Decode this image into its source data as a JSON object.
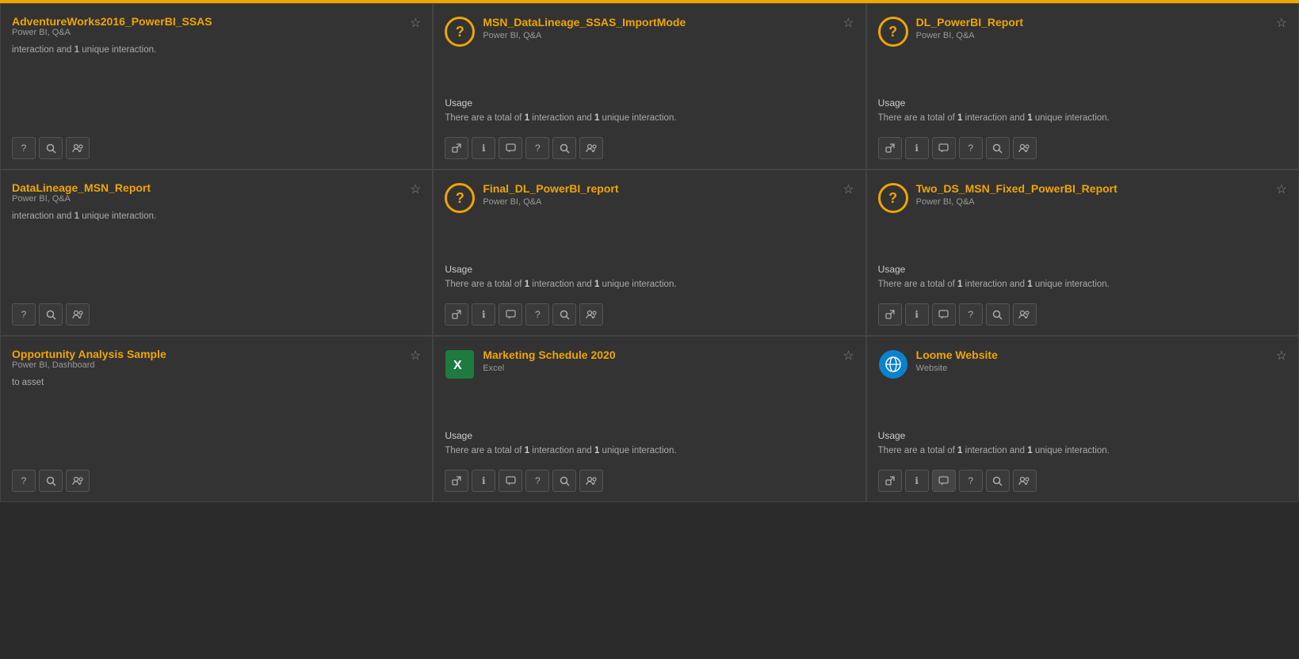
{
  "topBar": {},
  "cards": [
    {
      "id": "adventureworks",
      "partial": true,
      "title": "AdventureWorks2016_PowerBI_SSAS",
      "subtitle": "Power BI, Q&A",
      "iconType": "none",
      "usageLabel": "",
      "usageText": "interaction and",
      "usageBold": "1",
      "usageTextAfter": "unique interaction.",
      "starred": false,
      "buttons": [
        "external",
        "info",
        "search",
        "users"
      ]
    },
    {
      "id": "msn-datalineage",
      "partial": false,
      "title": "MSN_DataLineage_SSAS_ImportMode",
      "subtitle": "Power BI, Q&A",
      "iconType": "question",
      "usageLabel": "Usage",
      "usageTextBefore": "There are a total of",
      "usageBold1": "1",
      "usageMiddle": "interaction and",
      "usageBold2": "1",
      "usageTextAfter": "unique interaction.",
      "starred": false,
      "buttons": [
        "external",
        "info",
        "comment",
        "question",
        "search",
        "users"
      ]
    },
    {
      "id": "dl-powerbi-report",
      "partial": false,
      "title": "DL_PowerBI_Report",
      "subtitle": "Power BI, Q&A",
      "iconType": "question",
      "usageLabel": "Usage",
      "usageTextBefore": "There are a total of",
      "usageBold1": "1",
      "usageMiddle": "interaction and",
      "usageBold2": "1",
      "usageTextAfter": "unique interaction.",
      "starred": false,
      "buttons": [
        "external",
        "info",
        "comment",
        "question",
        "search",
        "users"
      ]
    },
    {
      "id": "datalineage-msn",
      "partial": true,
      "title": "DataLineage_MSN_Report",
      "subtitle": "Power BI, Q&A",
      "iconType": "none",
      "usageLabel": "",
      "usageTextBefore": "interaction and",
      "usageBold": "1",
      "usageTextAfter": "unique interaction.",
      "starred": false,
      "buttons": [
        "external",
        "info",
        "search",
        "users"
      ]
    },
    {
      "id": "final-dl-powerbi",
      "partial": false,
      "title": "Final_DL_PowerBI_report",
      "subtitle": "Power BI, Q&A",
      "iconType": "question",
      "usageLabel": "Usage",
      "usageTextBefore": "There are a total of",
      "usageBold1": "1",
      "usageMiddle": "interaction and",
      "usageBold2": "1",
      "usageTextAfter": "unique interaction.",
      "starred": false,
      "buttons": [
        "external",
        "info",
        "comment",
        "question",
        "search",
        "users"
      ]
    },
    {
      "id": "two-ds-msn",
      "partial": false,
      "title": "Two_DS_MSN_Fixed_PowerBI_Report",
      "subtitle": "Power BI, Q&A",
      "iconType": "question",
      "usageLabel": "Usage",
      "usageTextBefore": "There are a total of",
      "usageBold1": "1",
      "usageMiddle": "interaction and",
      "usageBold2": "1",
      "usageTextAfter": "unique interaction.",
      "starred": false,
      "buttons": [
        "external",
        "info",
        "comment",
        "question",
        "search",
        "users"
      ]
    },
    {
      "id": "opportunity-analysis",
      "partial": true,
      "title": "Opportunity Analysis Sample",
      "subtitle": "Power BI, Dashboard",
      "iconType": "none",
      "usageLabel": "",
      "usageText": "to asset",
      "starred": false,
      "buttons": [
        "external",
        "info",
        "search",
        "users"
      ]
    },
    {
      "id": "marketing-schedule",
      "partial": false,
      "title": "Marketing Schedule 2020",
      "subtitle": "Excel",
      "iconType": "excel",
      "usageLabel": "Usage",
      "usageTextBefore": "There are a total of",
      "usageBold1": "1",
      "usageMiddle": "interaction and",
      "usageBold2": "1",
      "usageTextAfter": "unique interaction.",
      "starred": false,
      "buttons": [
        "external",
        "info",
        "comment",
        "question",
        "search",
        "users"
      ]
    },
    {
      "id": "loome-website",
      "partial": false,
      "title": "Loome Website",
      "subtitle": "Website",
      "iconType": "ie",
      "usageLabel": "Usage",
      "usageTextBefore": "There are a total of",
      "usageBold1": "1",
      "usageMiddle": "interaction and",
      "usageBold2": "1",
      "usageTextAfter": "unique interaction.",
      "starred": false,
      "buttons": [
        "external",
        "info",
        "comment",
        "question",
        "search",
        "users"
      ]
    }
  ],
  "buttons": {
    "external": "↗",
    "info": "ℹ",
    "comment": "💬",
    "question": "?",
    "search": "🔍",
    "users": "👥"
  },
  "starEmpty": "☆",
  "starFilled": "★"
}
